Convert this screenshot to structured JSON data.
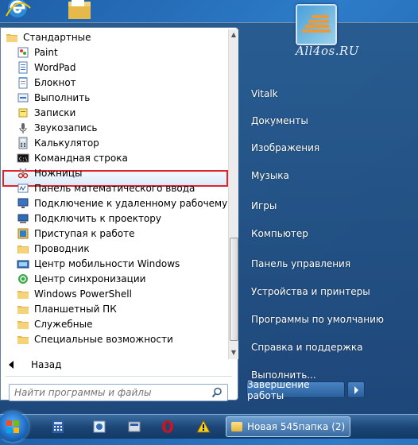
{
  "watermark": "All4os.RU",
  "programs": {
    "items": [
      {
        "label": "Стандартные",
        "icon": "folder-icon",
        "level": "root"
      },
      {
        "label": "Paint",
        "icon": "paint-icon",
        "level": "sub"
      },
      {
        "label": "WordPad",
        "icon": "wordpad-icon",
        "level": "sub"
      },
      {
        "label": "Блокнот",
        "icon": "notepad-icon",
        "level": "sub"
      },
      {
        "label": "Выполнить",
        "icon": "run-icon",
        "level": "sub"
      },
      {
        "label": "Записки",
        "icon": "sticky-notes-icon",
        "level": "sub"
      },
      {
        "label": "Звукозапись",
        "icon": "microphone-icon",
        "level": "sub"
      },
      {
        "label": "Калькулятор",
        "icon": "calculator-icon",
        "level": "sub"
      },
      {
        "label": "Командная строка",
        "icon": "cmd-icon",
        "level": "sub"
      },
      {
        "label": "Ножницы",
        "icon": "scissors-icon",
        "level": "sub"
      },
      {
        "label": "Панель математического ввода",
        "icon": "math-input-icon",
        "level": "sub"
      },
      {
        "label": "Подключение к удаленному рабочему стол",
        "icon": "remote-desktop-icon",
        "level": "sub"
      },
      {
        "label": "Подключить к проектору",
        "icon": "projector-icon",
        "level": "sub"
      },
      {
        "label": "Приступая к работе",
        "icon": "getting-started-icon",
        "level": "sub"
      },
      {
        "label": "Проводник",
        "icon": "explorer-icon",
        "level": "sub"
      },
      {
        "label": "Центр мобильности Windows",
        "icon": "mobility-center-icon",
        "level": "sub"
      },
      {
        "label": "Центр синхронизации",
        "icon": "sync-center-icon",
        "level": "sub"
      },
      {
        "label": "Windows PowerShell",
        "icon": "folder-icon",
        "level": "sub"
      },
      {
        "label": "Планшетный ПК",
        "icon": "folder-icon",
        "level": "sub"
      },
      {
        "label": "Служебные",
        "icon": "folder-icon",
        "level": "sub"
      },
      {
        "label": "Специальные возможности",
        "icon": "folder-icon",
        "level": "sub"
      }
    ],
    "back_label": "Назад"
  },
  "search": {
    "placeholder": "Найти программы и файлы"
  },
  "right_pane": {
    "items": [
      "Vitalk",
      "Документы",
      "Изображения",
      "Музыка",
      "Игры",
      "Компьютер",
      "Панель управления",
      "Устройства и принтеры",
      "Программы по умолчанию",
      "Справка и поддержка",
      "Выполнить..."
    ],
    "shutdown_label": "Завершение работы"
  },
  "taskbar": {
    "task_label": "Новая 545папка (2)"
  },
  "colors": {
    "highlight_border": "#e0242b",
    "taskbar": "#1c4677"
  }
}
